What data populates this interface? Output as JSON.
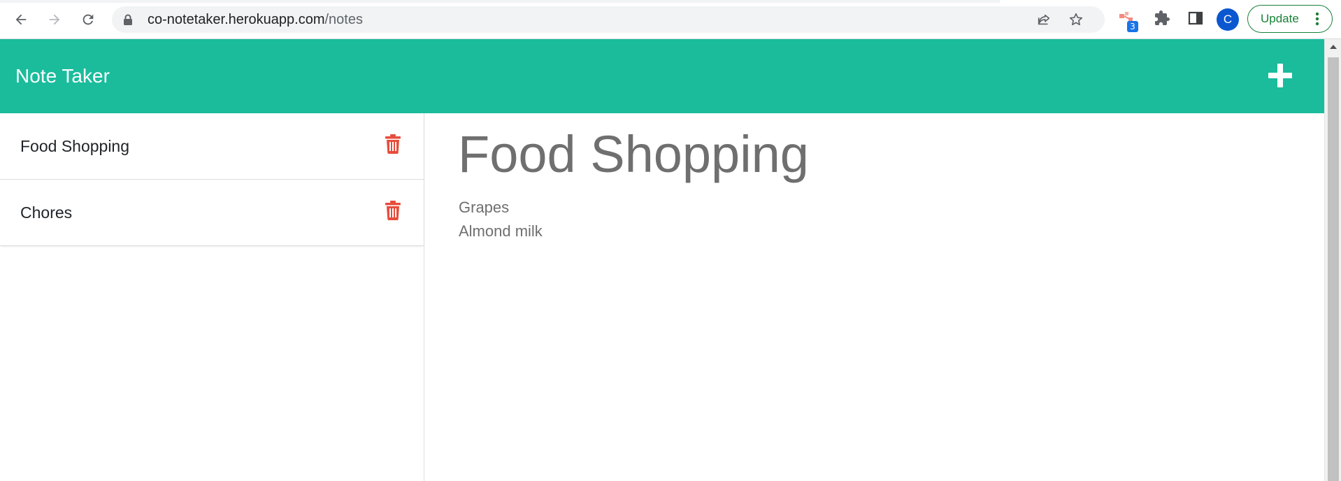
{
  "browser": {
    "url_host": "co-notetaker.herokuapp.com",
    "url_path": "/notes",
    "extension_badge": "3",
    "profile_initial": "C",
    "update_label": "Update",
    "icons": [
      "back-arrow-icon",
      "forward-arrow-icon",
      "reload-icon",
      "lock-icon",
      "share-icon",
      "star-icon",
      "extension-icon",
      "puzzle-icon",
      "side-panel-icon",
      "kebab-menu-icon"
    ]
  },
  "app": {
    "brand": "Note Taker",
    "new_note_icon": "plus-icon",
    "accent_color": "#1abc9c",
    "delete_color": "#e74c3c"
  },
  "notes": [
    {
      "title": "Food Shopping"
    },
    {
      "title": "Chores"
    }
  ],
  "active_note": {
    "title": "Food Shopping",
    "lines": [
      "Grapes",
      "Almond milk"
    ]
  }
}
